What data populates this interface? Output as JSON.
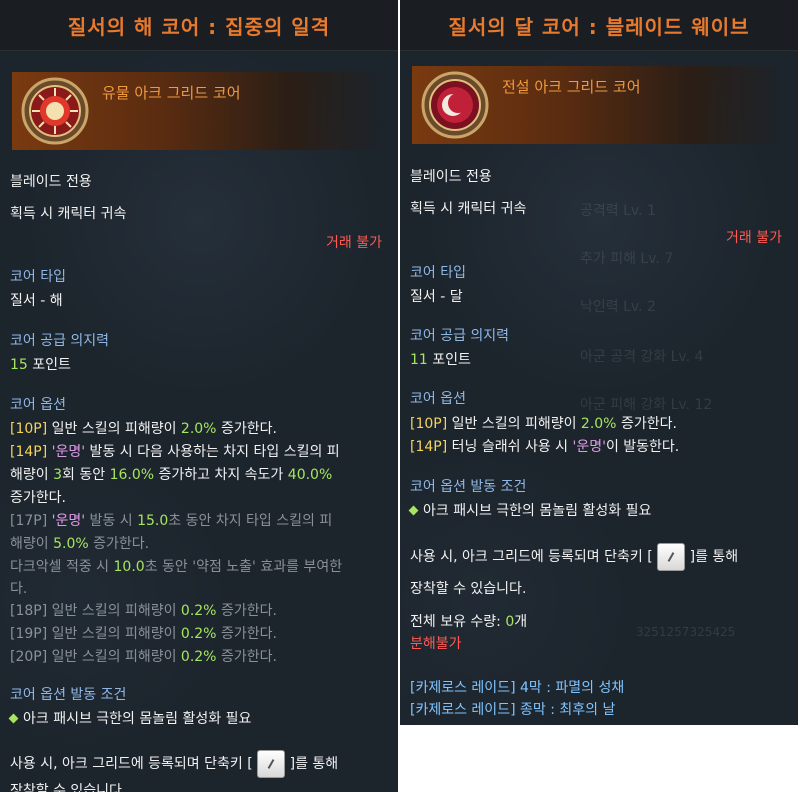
{
  "left": {
    "title": "질서의 해 코어 : 집중의 일격",
    "grade": "유물 아크 그리드 코어",
    "class_only": "블레이드 전용",
    "bind": "획득 시 캐릭터 귀속",
    "trade": "거래 불가",
    "core_type_label": "코어 타입",
    "core_type_value": "질서 - 해",
    "willpower_label": "코어 공급 의지력",
    "willpower_value": "15",
    "willpower_unit": " 포인트",
    "options_label": "코어 옵션",
    "options": {
      "o10": {
        "tag": "[10P]",
        "t1": " 일반 스킬의 피해량이 ",
        "v1": "2.0%",
        "t2": " 증가한다."
      },
      "o14": {
        "tag": "[14P]",
        "q": "'운명'",
        "t1": " 발동 시 다음 사용하는 차지 타입 스킬의 피",
        "t2": "해량이 ",
        "v2": "3",
        "t3": "회 동안 ",
        "v3": "16.0%",
        "t4": " 증가하고 차지 속도가 ",
        "v4": "40.0%",
        "t5": "증가한다."
      },
      "o17": {
        "tag": "[17P]",
        "q": "'운명'",
        "t1": " 발동 시 ",
        "v1": "15.0",
        "t2": "초 동안 차지 타입 스킬의 피",
        "t3": "해량이 ",
        "v3": "5.0%",
        "t4": " 증가한다.",
        "t5": "다크악셀 적중 시 ",
        "v5": "10.0",
        "t6": "초 동안 '약점 노출' 효과를 부여한",
        "t7": "다."
      },
      "o18": {
        "tag": "[18P]",
        "t1": " 일반 스킬의 피해량이 ",
        "v1": "0.2%",
        "t2": " 증가한다."
      },
      "o19": {
        "tag": "[19P]",
        "t1": " 일반 스킬의 피해량이 ",
        "v1": "0.2%",
        "t2": " 증가한다."
      },
      "o20": {
        "tag": "[20P]",
        "t1": " 일반 스킬의 피해량이 ",
        "v1": "0.2%",
        "t2": " 증가한다."
      }
    },
    "condition_label": "코어 옵션 발동 조건",
    "condition_text": "아크 패시브 극한의 몸놀림 활성화 필요",
    "usage_pre": "사용 시, 아크 그리드에 등록되며 단축키 [",
    "usage_post": "]를 통해",
    "usage_line2": "장착할 수 있습니다."
  },
  "right": {
    "title": "질서의 달 코어 : 블레이드 웨이브",
    "grade": "전설 아크 그리드 코어",
    "class_only": "블레이드 전용",
    "bind": "획득 시 캐릭터 귀속",
    "trade": "거래 불가",
    "core_type_label": "코어 타입",
    "core_type_value": "질서 - 달",
    "willpower_label": "코어 공급 의지력",
    "willpower_value": "11",
    "willpower_unit": " 포인트",
    "options_label": "코어 옵션",
    "options": {
      "o10": {
        "tag": "[10P]",
        "t1": " 일반 스킬의 피해량이 ",
        "v1": "2.0%",
        "t2": " 증가한다."
      },
      "o14": {
        "tag": "[14P]",
        "t1": " 터닝 슬래쉬 사용 시 ",
        "q": "'운명'",
        "t2": "이 발동한다."
      }
    },
    "condition_label": "코어 옵션 발동 조건",
    "condition_text": "아크 패시브 극한의 몸놀림 활성화 필요",
    "usage_pre": "사용 시, 아크 그리드에 등록되며 단축키 [",
    "usage_post": "]를 통해",
    "usage_line2": "장착할 수 있습니다.",
    "owned_label": "전체 보유 수량: ",
    "owned_value": "0",
    "owned_unit": "개",
    "disassemble": "분해불가",
    "source1": "[카제로스 레이드] 4막 : 파멸의 성채",
    "source2": "[카제로스 레이드] 종막 : 최후의 날",
    "background_text": [
      "공격력 Lv. 1",
      "추가 피해 Lv. 7",
      "낙인력 Lv. 2",
      "아군 공격 강화 Lv. 4",
      "아군 피해 강화 Lv. 12",
      "3251257325425"
    ]
  }
}
